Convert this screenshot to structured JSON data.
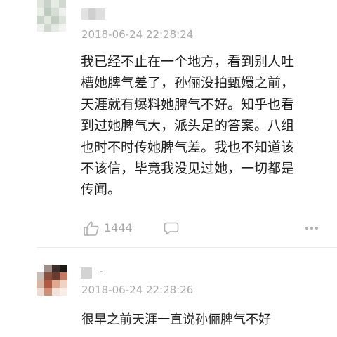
{
  "comments": [
    {
      "username": "",
      "timestamp": "2018-06-24 22:28:24",
      "text": "我已经不止在一个地方，看到别人吐\n槽她脾气差了，孙俪没拍甄嬛之前，\n天涯就有爆料她脾气不好。知乎也看\n到过她脾气大，派头足的答案。八组\n也时不时传她脾气差。我也不知道该\n不该信，毕竟我没见过她，一切都是\n传闻。",
      "like_count": "1444",
      "icons": [
        "thumbs-up-icon",
        "reply-icon",
        "more-icon"
      ]
    },
    {
      "username": "-",
      "timestamp": "2018-06-24 22:28:26",
      "text": "很早之前天涯一直说孙俪脾气不好"
    }
  ],
  "colors": {
    "text": "#1f1f1f",
    "muted": "#a9a9a9",
    "divider": "#ececec"
  }
}
